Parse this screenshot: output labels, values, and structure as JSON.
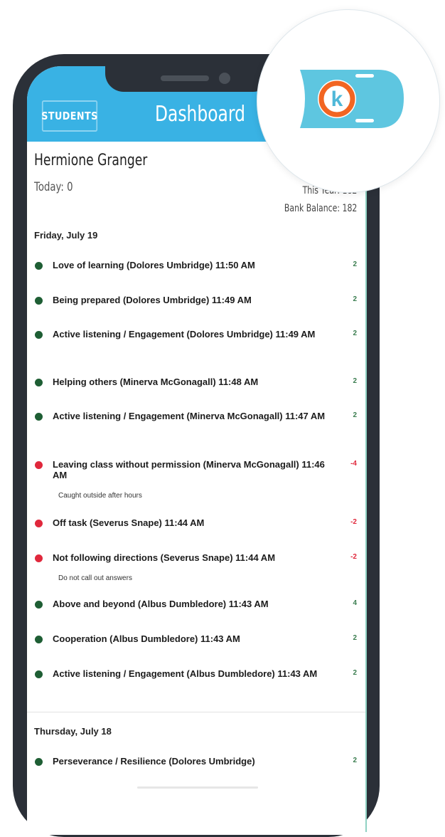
{
  "header": {
    "students_button": "STUDENTS",
    "title": "Dashboard"
  },
  "student": {
    "name": "Hermione Granger",
    "today": "Today: 0",
    "this_year": "This Year: 182",
    "bank_balance": "Bank Balance: 182"
  },
  "days": [
    {
      "date": "Friday, July 19",
      "entries": [
        {
          "text": "Love of learning (Dolores Umbridge) 11:50 AM",
          "points": "2",
          "type": "positive"
        },
        {
          "text": "Being prepared (Dolores Umbridge) 11:49 AM",
          "points": "2",
          "type": "positive"
        },
        {
          "text": "Active listening / Engagement (Dolores Umbridge) 11:49 AM",
          "points": "2",
          "type": "positive"
        },
        {
          "text": "Helping others (Minerva McGonagall) 11:48 AM",
          "points": "2",
          "type": "positive"
        },
        {
          "text": "Active listening / Engagement (Minerva McGonagall) 11:47 AM",
          "points": "2",
          "type": "positive"
        },
        {
          "text": "Leaving class without permission (Minerva McGonagall) 11:46 AM",
          "points": "-4",
          "type": "negative",
          "note": "Caught outside after hours"
        },
        {
          "text": "Off task (Severus Snape) 11:44 AM",
          "points": "-2",
          "type": "negative"
        },
        {
          "text": "Not following directions (Severus Snape) 11:44 AM",
          "points": "-2",
          "type": "negative",
          "note": "Do not call out answers"
        },
        {
          "text": "Above and beyond (Albus Dumbledore) 11:43 AM",
          "points": "4",
          "type": "positive"
        },
        {
          "text": "Cooperation (Albus Dumbledore) 11:43 AM",
          "points": "2",
          "type": "positive"
        },
        {
          "text": "Active listening / Engagement (Albus Dumbledore) 11:43 AM",
          "points": "2",
          "type": "positive"
        }
      ]
    },
    {
      "date": "Thursday, July 18",
      "entries": [
        {
          "text": "Perseverance / Resilience (Dolores Umbridge)",
          "points": "2",
          "type": "positive"
        }
      ]
    }
  ],
  "logo": {
    "letter": "k",
    "icon": "ticket-logo-icon"
  },
  "colors": {
    "header": "#39b2e4",
    "positive": "#1e5e34",
    "negative": "#e0283c",
    "logo_ticket": "#5ec6e0",
    "logo_ring": "#f26522"
  }
}
